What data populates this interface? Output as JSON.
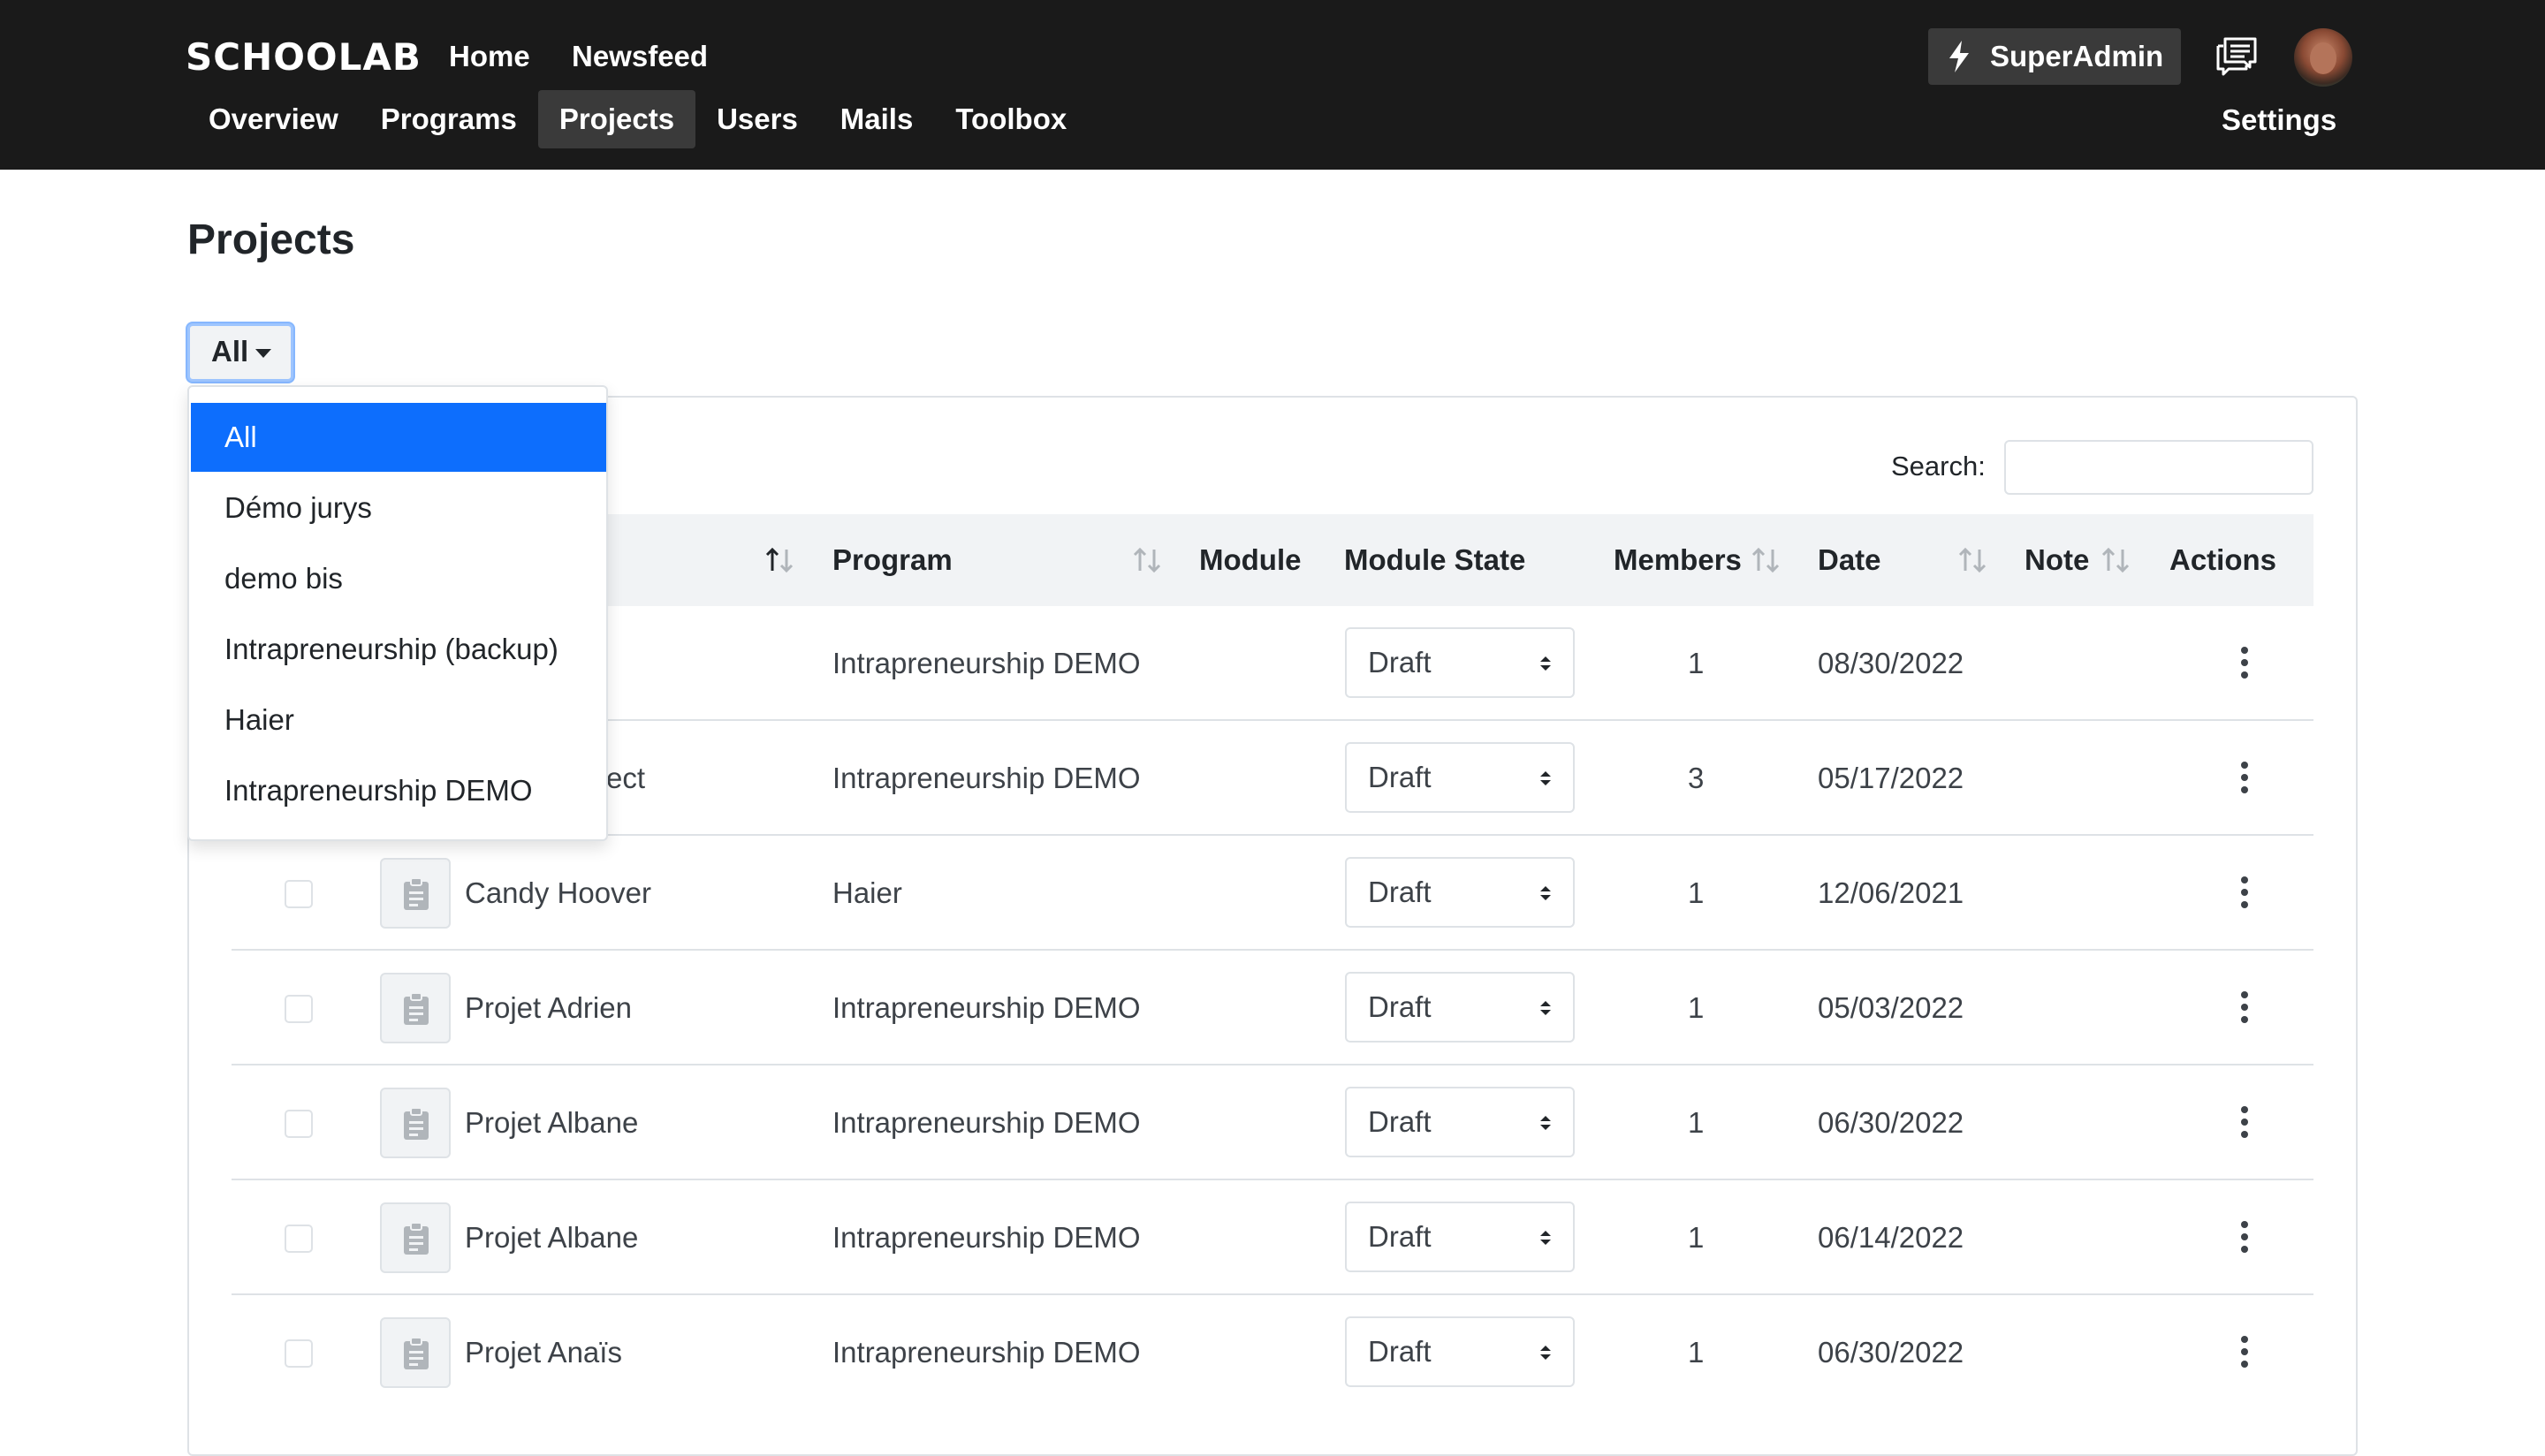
{
  "app": {
    "logo": "SCHOOLAB"
  },
  "top_links": {
    "home": "Home",
    "newsfeed": "Newsfeed"
  },
  "nav": [
    {
      "label": "Overview",
      "active": false
    },
    {
      "label": "Programs",
      "active": false
    },
    {
      "label": "Projects",
      "active": true
    },
    {
      "label": "Users",
      "active": false
    },
    {
      "label": "Mails",
      "active": false
    },
    {
      "label": "Toolbox",
      "active": false
    }
  ],
  "user": {
    "role_button": "SuperAdmin",
    "settings": "Settings"
  },
  "icons": {
    "bolt": "bolt-icon",
    "chat": "chat-icon",
    "clipboard": "clipboard-icon",
    "sort": "sort-icon",
    "kebab": "kebab-menu-icon",
    "caret": "caret-down-icon"
  },
  "colors": {
    "topbar": "#1a1a1a",
    "accent": "#0d6efd",
    "nav_active": "#3a3a3a"
  },
  "page": {
    "title": "Projects"
  },
  "filter": {
    "selected": "All",
    "options": [
      "All",
      "Démo jurys",
      "demo bis",
      "Intrapreneurship (backup)",
      "Haier",
      "Intrapreneurship DEMO"
    ]
  },
  "search": {
    "label": "Search:",
    "value": ""
  },
  "table": {
    "columns": {
      "program": "Program",
      "module": "Module",
      "module_state": "Module State",
      "members": "Members",
      "date": "Date",
      "note": "Note",
      "actions": "Actions"
    },
    "rows": [
      {
        "name": "",
        "program": "Intrapreneurship DEMO",
        "state": "Draft",
        "members": "1",
        "date": "08/30/2022"
      },
      {
        "name": "ect",
        "program": "Intrapreneurship DEMO",
        "state": "Draft",
        "members": "3",
        "date": "05/17/2022"
      },
      {
        "name": "Candy Hoover",
        "program": "Haier",
        "state": "Draft",
        "members": "1",
        "date": "12/06/2021"
      },
      {
        "name": "Projet Adrien",
        "program": "Intrapreneurship DEMO",
        "state": "Draft",
        "members": "1",
        "date": "05/03/2022"
      },
      {
        "name": "Projet Albane",
        "program": "Intrapreneurship DEMO",
        "state": "Draft",
        "members": "1",
        "date": "06/30/2022"
      },
      {
        "name": "Projet Albane",
        "program": "Intrapreneurship DEMO",
        "state": "Draft",
        "members": "1",
        "date": "06/14/2022"
      },
      {
        "name": "Projet Anaïs",
        "program": "Intrapreneurship DEMO",
        "state": "Draft",
        "members": "1",
        "date": "06/30/2022"
      }
    ]
  }
}
